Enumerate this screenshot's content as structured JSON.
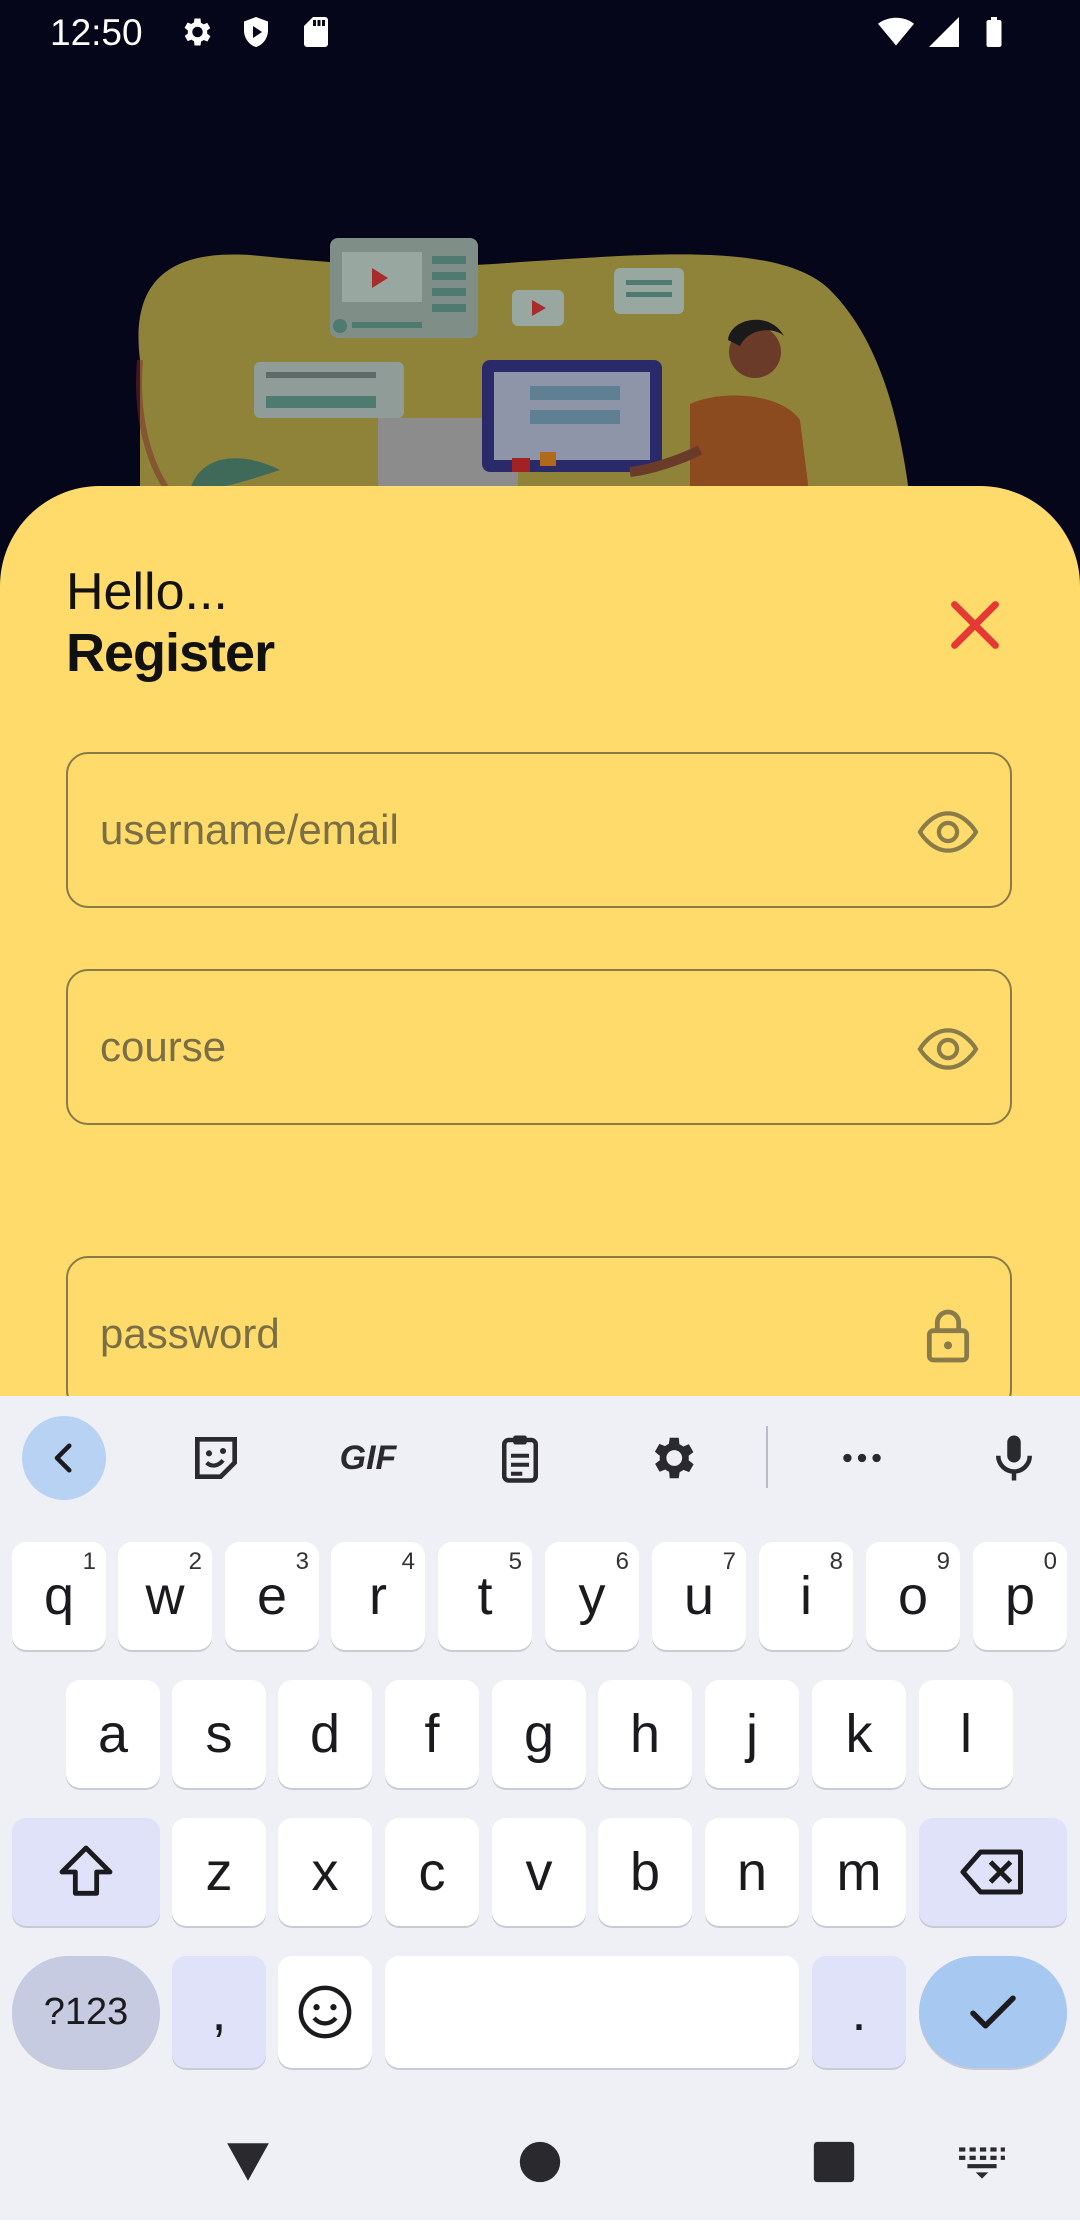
{
  "status_bar": {
    "time": "12:50",
    "icons": [
      "settings-icon",
      "shield-icon",
      "sd-card-icon",
      "wifi-icon",
      "signal-icon",
      "battery-icon"
    ]
  },
  "form": {
    "greeting": "Hello...",
    "title": "Register",
    "fields": [
      {
        "placeholder": "username/email",
        "icon": "eye-icon"
      },
      {
        "placeholder": "course",
        "icon": "eye-icon"
      },
      {
        "placeholder": "password",
        "icon": "lock-icon"
      }
    ],
    "close_icon": "close-icon",
    "accent_color": "#fedb6a",
    "close_color": "#e53935"
  },
  "keyboard": {
    "toolbar": {
      "gif_label": "GIF",
      "icons": [
        "back-arrow-icon",
        "sticker-icon",
        "gif-icon",
        "clipboard-icon",
        "gear-icon",
        "more-icon",
        "microphone-icon"
      ]
    },
    "rows": [
      [
        {
          "label": "q",
          "hint": "1"
        },
        {
          "label": "w",
          "hint": "2"
        },
        {
          "label": "e",
          "hint": "3"
        },
        {
          "label": "r",
          "hint": "4"
        },
        {
          "label": "t",
          "hint": "5"
        },
        {
          "label": "y",
          "hint": "6"
        },
        {
          "label": "u",
          "hint": "7"
        },
        {
          "label": "i",
          "hint": "8"
        },
        {
          "label": "o",
          "hint": "9"
        },
        {
          "label": "p",
          "hint": "0"
        }
      ],
      [
        {
          "label": "a"
        },
        {
          "label": "s"
        },
        {
          "label": "d"
        },
        {
          "label": "f"
        },
        {
          "label": "g"
        },
        {
          "label": "h"
        },
        {
          "label": "j"
        },
        {
          "label": "k"
        },
        {
          "label": "l"
        }
      ],
      [
        {
          "label": "z"
        },
        {
          "label": "x"
        },
        {
          "label": "c"
        },
        {
          "label": "v"
        },
        {
          "label": "b"
        },
        {
          "label": "n"
        },
        {
          "label": "m"
        }
      ]
    ],
    "bottom": {
      "symbols_label": "?123",
      "comma_label": ",",
      "period_label": "."
    }
  },
  "nav_bar": {
    "icons": [
      "back-triangle-icon",
      "home-circle-icon",
      "recents-square-icon",
      "keyboard-switch-icon"
    ]
  }
}
